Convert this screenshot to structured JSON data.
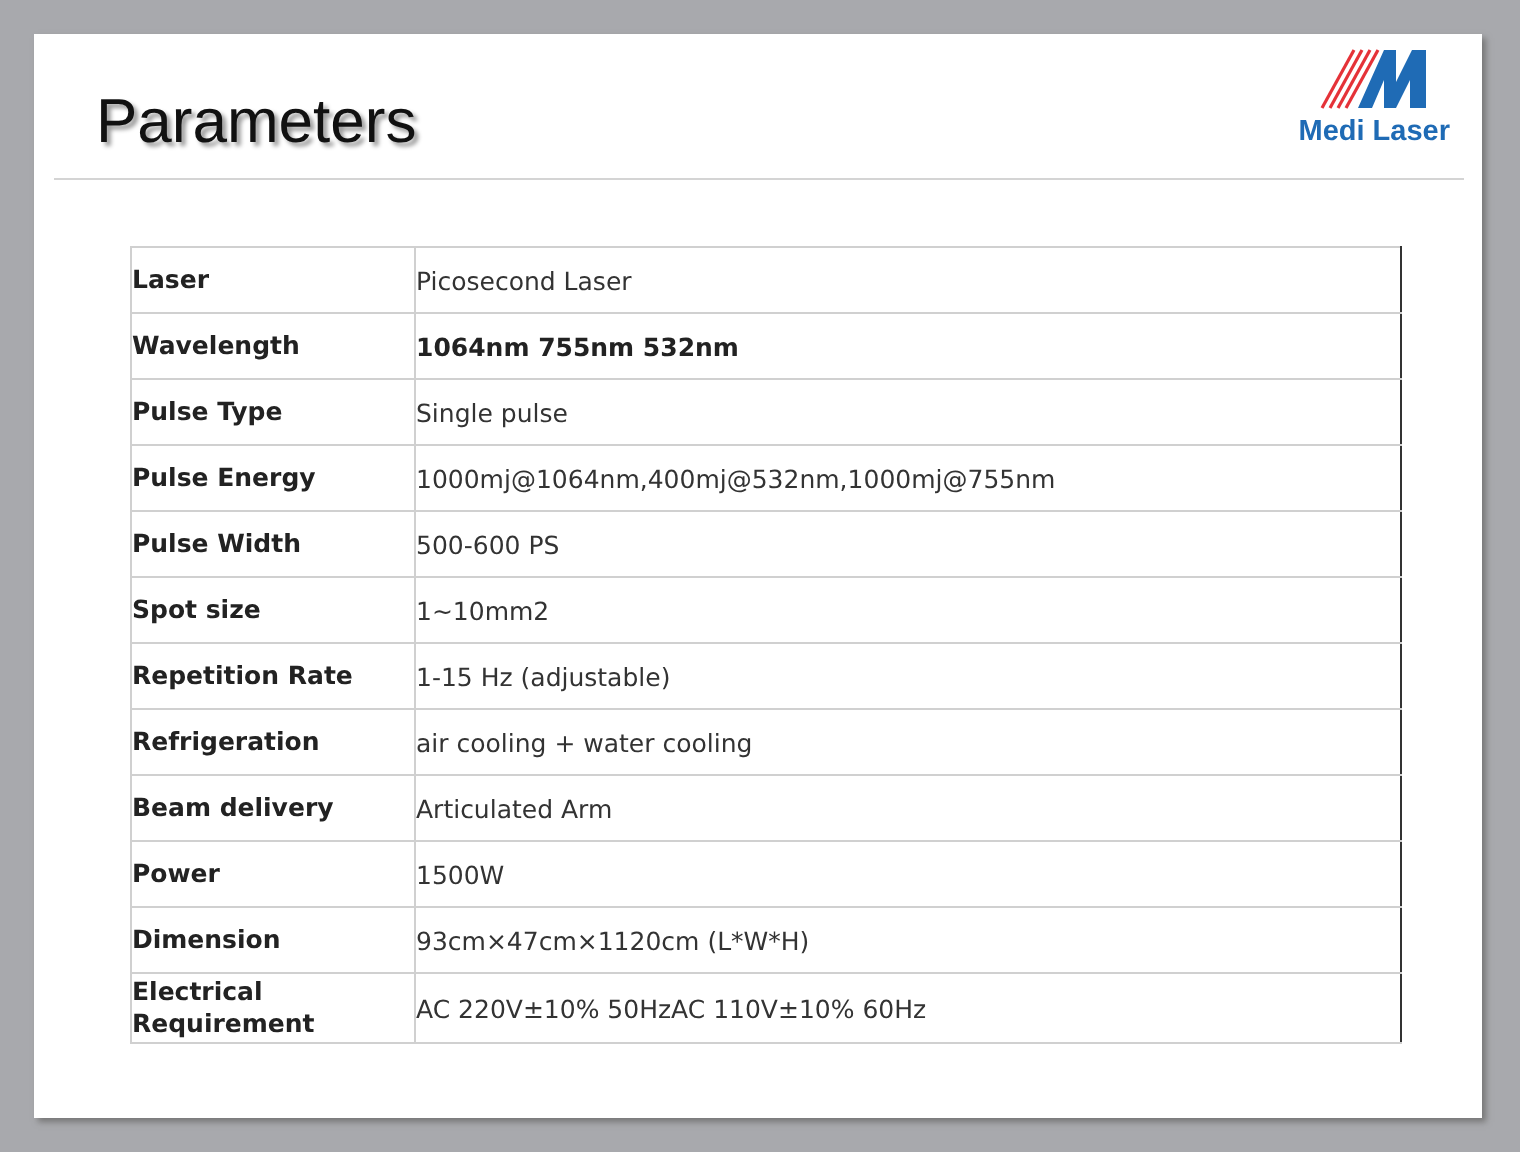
{
  "slide": {
    "title": "Parameters",
    "logo_text": "Medi Laser"
  },
  "table": {
    "rows": [
      {
        "label": "Laser",
        "value": "Picosecond Laser",
        "bold": false
      },
      {
        "label": "Wavelength",
        "value": "1064nm 755nm 532nm",
        "bold": true
      },
      {
        "label": "Pulse Type",
        "value": "Single pulse",
        "bold": false
      },
      {
        "label": "Pulse Energy",
        "value": "1000mj@1064nm,400mj@532nm,1000mj@755nm",
        "bold": false
      },
      {
        "label": "Pulse Width",
        "value": "500-600 PS",
        "bold": false
      },
      {
        "label": "Spot size",
        "value": "1~10mm2",
        "bold": false
      },
      {
        "label": "Repetition Rate",
        "value": "1-15 Hz (adjustable)",
        "bold": false
      },
      {
        "label": "Refrigeration",
        "value": "air cooling + water cooling",
        "bold": false
      },
      {
        "label": "Beam delivery",
        "value": "Articulated Arm",
        "bold": false
      },
      {
        "label": "Power",
        "value": "1500W",
        "bold": false
      },
      {
        "label": "Dimension",
        "value": "93cm×47cm×1120cm (L*W*H)",
        "bold": false
      },
      {
        "label": "Electrical Requirement",
        "value": "AC 220V±10% 50HzAC 110V±10% 60Hz",
        "bold": false
      }
    ]
  }
}
